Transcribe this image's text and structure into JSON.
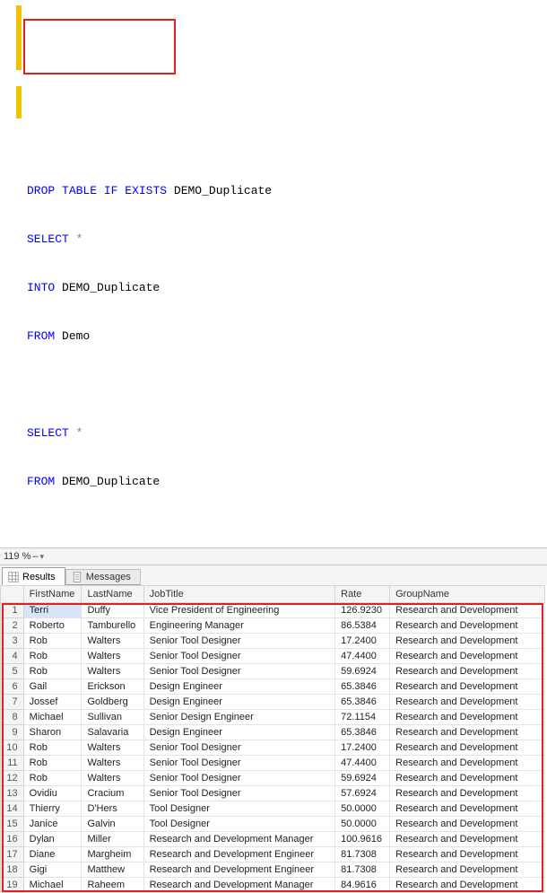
{
  "sql": {
    "lines": [
      {
        "pre": "",
        "kw1": "DROP",
        "mid1": " ",
        "kw2": "TABLE",
        "mid2": " ",
        "kw3": "IF",
        "mid3": " ",
        "kw4": "EXISTS",
        "tail": " DEMO_Duplicate"
      },
      {
        "pre": "",
        "kw1": "SELECT",
        "mid1": " ",
        "gr": "*",
        "tail": ""
      },
      {
        "pre": "",
        "kw1": "INTO",
        "tail": " DEMO_Duplicate"
      },
      {
        "pre": "",
        "kw1": "FROM",
        "tail": " Demo"
      },
      {
        "blank": true
      },
      {
        "pre": "",
        "kw1": "SELECT",
        "mid1": " ",
        "gr": "*",
        "tail": ""
      },
      {
        "pre": "",
        "kw1": "FROM",
        "tail": " DEMO_Duplicate"
      }
    ]
  },
  "zoom": {
    "label": "119 %",
    "dash": "–",
    "arrow": "▾"
  },
  "tabs": {
    "results": "Results",
    "messages": "Messages"
  },
  "grid": {
    "columns": [
      "FirstName",
      "LastName",
      "JobTitle",
      "Rate",
      "GroupName"
    ],
    "rows": [
      {
        "n": 1,
        "FirstName": "Terri",
        "LastName": "Duffy",
        "JobTitle": "Vice President of Engineering",
        "Rate": "126.9230",
        "GroupName": "Research and Development"
      },
      {
        "n": 2,
        "FirstName": "Roberto",
        "LastName": "Tamburello",
        "JobTitle": "Engineering Manager",
        "Rate": "86.5384",
        "GroupName": "Research and Development"
      },
      {
        "n": 3,
        "FirstName": "Rob",
        "LastName": "Walters",
        "JobTitle": "Senior Tool Designer",
        "Rate": "17.2400",
        "GroupName": "Research and Development"
      },
      {
        "n": 4,
        "FirstName": "Rob",
        "LastName": "Walters",
        "JobTitle": "Senior Tool Designer",
        "Rate": "47.4400",
        "GroupName": "Research and Development"
      },
      {
        "n": 5,
        "FirstName": "Rob",
        "LastName": "Walters",
        "JobTitle": "Senior Tool Designer",
        "Rate": "59.6924",
        "GroupName": "Research and Development"
      },
      {
        "n": 6,
        "FirstName": "Gail",
        "LastName": "Erickson",
        "JobTitle": "Design Engineer",
        "Rate": "65.3846",
        "GroupName": "Research and Development"
      },
      {
        "n": 7,
        "FirstName": "Jossef",
        "LastName": "Goldberg",
        "JobTitle": "Design Engineer",
        "Rate": "65.3846",
        "GroupName": "Research and Development"
      },
      {
        "n": 8,
        "FirstName": "Michael",
        "LastName": "Sullivan",
        "JobTitle": "Senior Design Engineer",
        "Rate": "72.1154",
        "GroupName": "Research and Development"
      },
      {
        "n": 9,
        "FirstName": "Sharon",
        "LastName": "Salavaria",
        "JobTitle": "Design Engineer",
        "Rate": "65.3846",
        "GroupName": "Research and Development"
      },
      {
        "n": 10,
        "FirstName": "Rob",
        "LastName": "Walters",
        "JobTitle": "Senior Tool Designer",
        "Rate": "17.2400",
        "GroupName": "Research and Development"
      },
      {
        "n": 11,
        "FirstName": "Rob",
        "LastName": "Walters",
        "JobTitle": "Senior Tool Designer",
        "Rate": "47.4400",
        "GroupName": "Research and Development"
      },
      {
        "n": 12,
        "FirstName": "Rob",
        "LastName": "Walters",
        "JobTitle": "Senior Tool Designer",
        "Rate": "59.6924",
        "GroupName": "Research and Development"
      },
      {
        "n": 13,
        "FirstName": "Ovidiu",
        "LastName": "Cracium",
        "JobTitle": "Senior Tool Designer",
        "Rate": "57.6924",
        "GroupName": "Research and Development"
      },
      {
        "n": 14,
        "FirstName": "Thierry",
        "LastName": "D'Hers",
        "JobTitle": "Tool Designer",
        "Rate": "50.0000",
        "GroupName": "Research and Development"
      },
      {
        "n": 15,
        "FirstName": "Janice",
        "LastName": "Galvin",
        "JobTitle": "Tool Designer",
        "Rate": "50.0000",
        "GroupName": "Research and Development"
      },
      {
        "n": 16,
        "FirstName": "Dylan",
        "LastName": "Miller",
        "JobTitle": "Research and Development Manager",
        "Rate": "100.9616",
        "GroupName": "Research and Development"
      },
      {
        "n": 17,
        "FirstName": "Diane",
        "LastName": "Margheim",
        "JobTitle": "Research and Development Engineer",
        "Rate": "81.7308",
        "GroupName": "Research and Development"
      },
      {
        "n": 18,
        "FirstName": "Gigi",
        "LastName": "Matthew",
        "JobTitle": "Research and Development Engineer",
        "Rate": "81.7308",
        "GroupName": "Research and Development"
      },
      {
        "n": 19,
        "FirstName": "Michael",
        "LastName": "Raheem",
        "JobTitle": "Research and Development Manager",
        "Rate": "84.9616",
        "GroupName": "Research and Development"
      }
    ]
  }
}
